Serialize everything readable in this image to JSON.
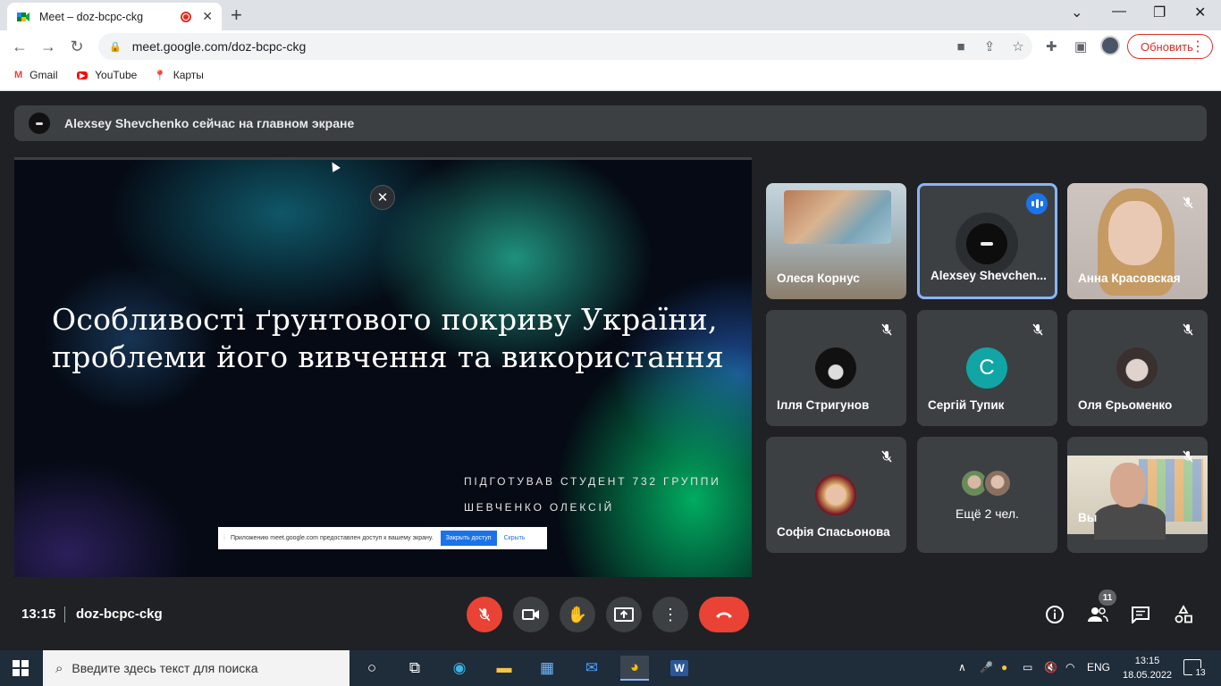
{
  "browser": {
    "tab_title": "Meet – doz-bcpc-ckg",
    "url": "meet.google.com/doz-bcpc-ckg",
    "update_label": "Обновить",
    "bookmarks": [
      {
        "label": "Gmail",
        "icon": "gmail-icon"
      },
      {
        "label": "YouTube",
        "icon": "youtube-icon"
      },
      {
        "label": "Карты",
        "icon": "maps-icon"
      }
    ]
  },
  "meet": {
    "banner_text": "Alexsey Shevchenko сейчас на главном экране",
    "slide": {
      "title_line1": "Особливості ґрунтового покриву України,",
      "title_line2": "проблеми його вивчення та використання",
      "author_line1": "ПІДГОТУВАВ СТУДЕНТ 732 ГРУППИ",
      "author_line2": "ШЕВЧЕНКО ОЛЕКСІЙ"
    },
    "share_notice": {
      "text": "Приложению meet.google.com предоставлен доступ к вашему экрану.",
      "stop_label": "Закрыть доступ",
      "hide_label": "Скрыть"
    },
    "participants": [
      {
        "name": "Олеся Корнус",
        "muted": false
      },
      {
        "name": "Alexsey Shevchen...",
        "speaking": true
      },
      {
        "name": "Анна Красовская",
        "muted": true
      },
      {
        "name": "Ілля Стригунов",
        "muted": true
      },
      {
        "name": "Сергій Тупик",
        "muted": true,
        "initial": "С"
      },
      {
        "name": "Оля Єрьоменко",
        "muted": true
      },
      {
        "name": "Софія Спасьонова",
        "muted": true
      },
      {
        "name": "Ещё 2 чел."
      },
      {
        "name": "Вы",
        "muted": true
      }
    ],
    "clock": "13:15",
    "meeting_code": "doz-bcpc-ckg",
    "participants_count": "11",
    "colors": {
      "accent": "#8ab4f8",
      "end_call": "#ea4335",
      "bg": "#202124",
      "tile": "#3c4043"
    }
  },
  "taskbar": {
    "search_placeholder": "Введите здесь текст для поиска",
    "lang": "ENG",
    "time": "13:15",
    "date": "18.05.2022",
    "notifications": "13"
  }
}
